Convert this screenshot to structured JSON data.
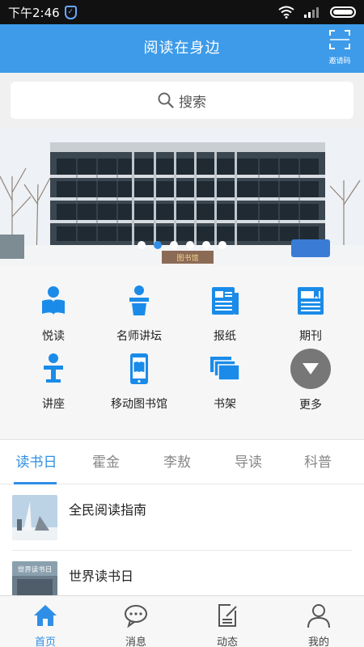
{
  "status_bar": {
    "time": "下午2:46"
  },
  "header": {
    "title": "阅读在身边",
    "invite_label": "邀请码"
  },
  "search": {
    "label": "搜索"
  },
  "banner": {
    "sign_text": "图书馆",
    "page_count": 6,
    "active_index": 1
  },
  "grid": [
    {
      "label": "悦读",
      "icon": "reader-icon"
    },
    {
      "label": "名师讲坛",
      "icon": "podium-icon"
    },
    {
      "label": "报纸",
      "icon": "newspaper-icon"
    },
    {
      "label": "期刊",
      "icon": "journal-icon"
    },
    {
      "label": "讲座",
      "icon": "lecture-icon"
    },
    {
      "label": "移动图书馆",
      "icon": "phone-book-icon"
    },
    {
      "label": "书架",
      "icon": "bookshelf-icon"
    },
    {
      "label": "更多",
      "icon": "more-icon"
    }
  ],
  "tabs": [
    "读书日",
    "霍金",
    "李敖",
    "导读",
    "科普"
  ],
  "list": [
    {
      "title": "全民阅读指南"
    },
    {
      "title": "世界读书日",
      "thumb_text": "世界读书日"
    }
  ],
  "bottom_nav": [
    {
      "label": "首页",
      "icon": "home-icon",
      "active": true
    },
    {
      "label": "消息",
      "icon": "message-icon",
      "active": false
    },
    {
      "label": "动态",
      "icon": "feed-icon",
      "active": false
    },
    {
      "label": "我的",
      "icon": "profile-icon",
      "active": false
    }
  ],
  "colors": {
    "primary": "#3d9be9",
    "accent": "#2f8fe6",
    "icon_blue": "#1a8be8"
  }
}
